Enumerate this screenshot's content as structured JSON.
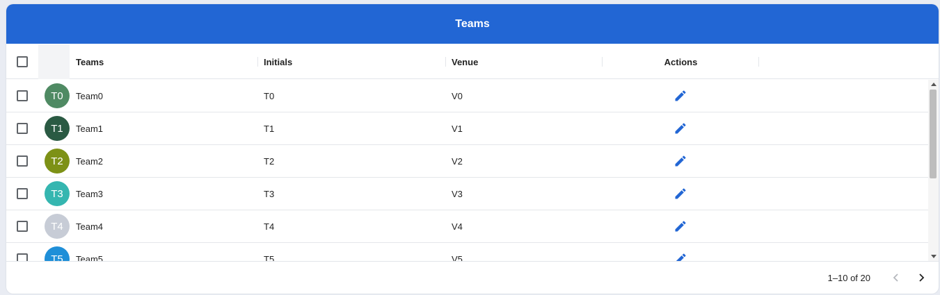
{
  "header": {
    "title": "Teams"
  },
  "columns": {
    "teams": "Teams",
    "initials": "Initials",
    "venue": "Venue",
    "actions": "Actions"
  },
  "rows": [
    {
      "avatar": "T0",
      "avatar_color": "#4f8a63",
      "team": "Team0",
      "initials": "T0",
      "venue": "V0"
    },
    {
      "avatar": "T1",
      "avatar_color": "#2a5a43",
      "team": "Team1",
      "initials": "T1",
      "venue": "V1"
    },
    {
      "avatar": "T2",
      "avatar_color": "#7d9116",
      "team": "Team2",
      "initials": "T2",
      "venue": "V2"
    },
    {
      "avatar": "T3",
      "avatar_color": "#35b6b0",
      "team": "Team3",
      "initials": "T3",
      "venue": "V3"
    },
    {
      "avatar": "T4",
      "avatar_color": "#c7ccd6",
      "team": "Team4",
      "initials": "T4",
      "venue": "V4"
    },
    {
      "avatar": "T5",
      "avatar_color": "#1f8fd8",
      "team": "Team5",
      "initials": "T5",
      "venue": "V5"
    }
  ],
  "footer": {
    "range": "1–10 of 20"
  },
  "colors": {
    "header_bg": "#2266d4",
    "accent": "#2266d4"
  },
  "icons": {
    "edit": "pencil-icon",
    "prev": "chevron-left-icon",
    "next": "chevron-right-icon"
  }
}
